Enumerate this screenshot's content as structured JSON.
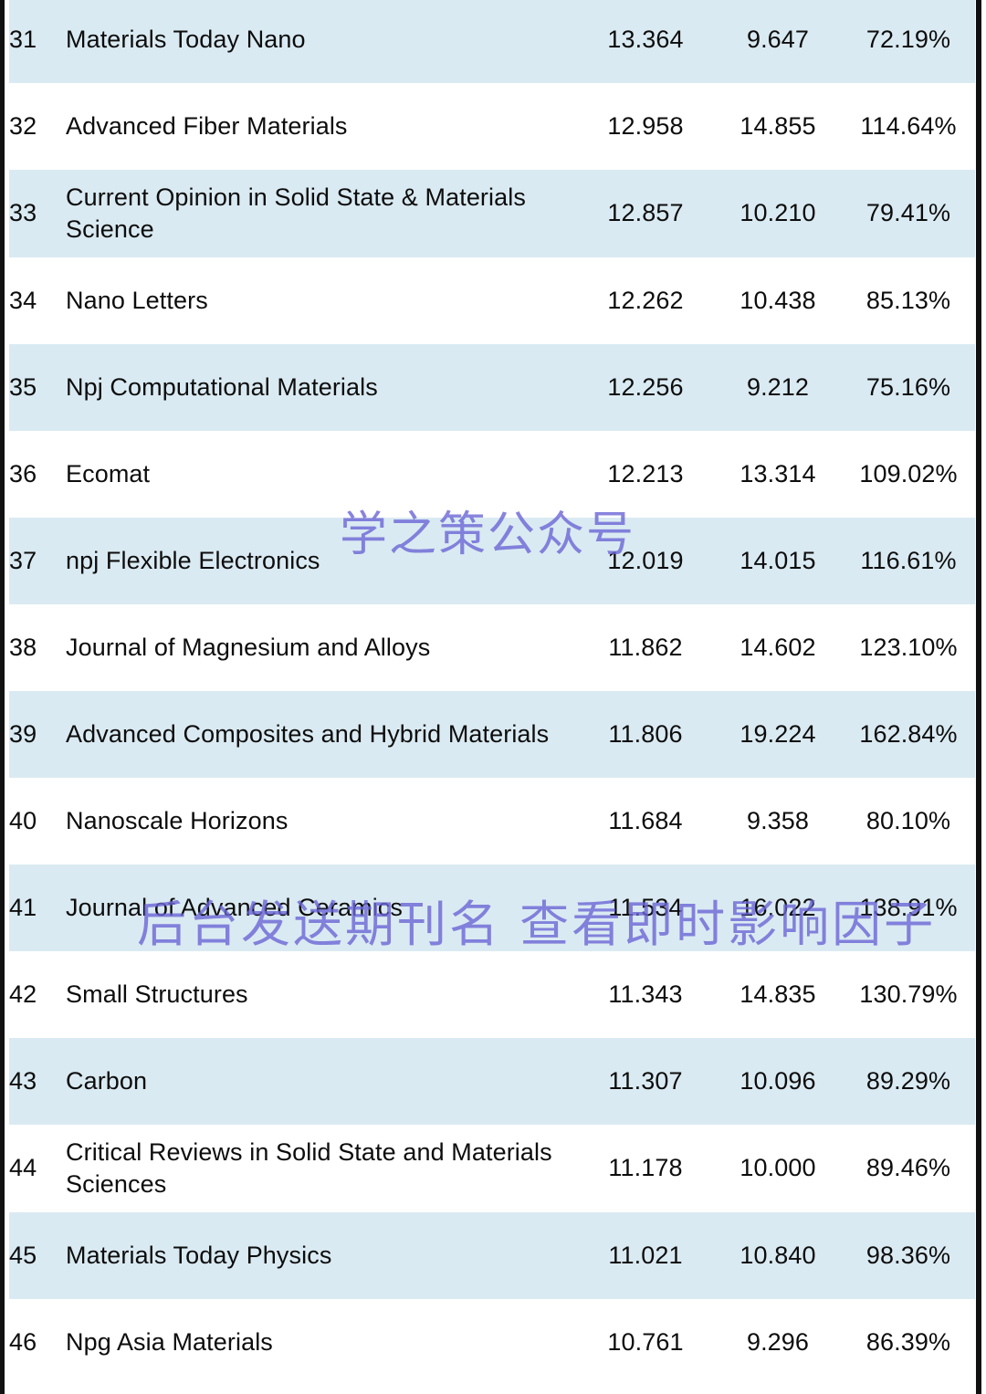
{
  "page": {
    "background_color": "#ffffff",
    "shaded_row_color": "#daeaf2",
    "text_color": "#0d0d0d",
    "edge_color": "#111111"
  },
  "watermarks": {
    "top": "学之策公众号",
    "middle": "后台发送期刊名 查看即时影响因子",
    "color": "#6b66d6"
  },
  "table": {
    "columns": [
      "rank",
      "journal",
      "impact_factor",
      "previous_value",
      "ratio"
    ],
    "rows": [
      {
        "rank": "31",
        "journal": "Materials Today Nano",
        "impact_factor": "13.364",
        "previous_value": "9.647",
        "ratio": "72.19%",
        "shaded": true,
        "lines": 1
      },
      {
        "rank": "32",
        "journal": "Advanced Fiber Materials",
        "impact_factor": "12.958",
        "previous_value": "14.855",
        "ratio": "114.64%",
        "shaded": false,
        "lines": 1
      },
      {
        "rank": "33",
        "journal": "Current Opinion in Solid State & Materials Science",
        "impact_factor": "12.857",
        "previous_value": "10.210",
        "ratio": "79.41%",
        "shaded": true,
        "lines": 2
      },
      {
        "rank": "34",
        "journal": "Nano Letters",
        "impact_factor": "12.262",
        "previous_value": "10.438",
        "ratio": "85.13%",
        "shaded": false,
        "lines": 1
      },
      {
        "rank": "35",
        "journal": "Npj Computational Materials",
        "impact_factor": "12.256",
        "previous_value": "9.212",
        "ratio": "75.16%",
        "shaded": true,
        "lines": 1
      },
      {
        "rank": "36",
        "journal": "Ecomat",
        "impact_factor": "12.213",
        "previous_value": "13.314",
        "ratio": "109.02%",
        "shaded": false,
        "lines": 1
      },
      {
        "rank": "37",
        "journal": "npj Flexible Electronics",
        "impact_factor": "12.019",
        "previous_value": "14.015",
        "ratio": "116.61%",
        "shaded": true,
        "lines": 1
      },
      {
        "rank": "38",
        "journal": "Journal of Magnesium and Alloys",
        "impact_factor": "11.862",
        "previous_value": "14.602",
        "ratio": "123.10%",
        "shaded": false,
        "lines": 1
      },
      {
        "rank": "39",
        "journal": "Advanced Composites and Hybrid Materials",
        "impact_factor": "11.806",
        "previous_value": "19.224",
        "ratio": "162.84%",
        "shaded": true,
        "lines": 1
      },
      {
        "rank": "40",
        "journal": "Nanoscale Horizons",
        "impact_factor": "11.684",
        "previous_value": "9.358",
        "ratio": "80.10%",
        "shaded": false,
        "lines": 1
      },
      {
        "rank": "41",
        "journal": "Journal of Advanced Ceramics",
        "impact_factor": "11.534",
        "previous_value": "16.022",
        "ratio": "138.91%",
        "shaded": true,
        "lines": 1
      },
      {
        "rank": "42",
        "journal": "Small Structures",
        "impact_factor": "11.343",
        "previous_value": "14.835",
        "ratio": "130.79%",
        "shaded": false,
        "lines": 1
      },
      {
        "rank": "43",
        "journal": "Carbon",
        "impact_factor": "11.307",
        "previous_value": "10.096",
        "ratio": "89.29%",
        "shaded": true,
        "lines": 1
      },
      {
        "rank": "44",
        "journal": "Critical Reviews in Solid State and Materials Sciences",
        "impact_factor": "11.178",
        "previous_value": "10.000",
        "ratio": "89.46%",
        "shaded": false,
        "lines": 2
      },
      {
        "rank": "45",
        "journal": "Materials Today Physics",
        "impact_factor": "11.021",
        "previous_value": "10.840",
        "ratio": "98.36%",
        "shaded": true,
        "lines": 1
      },
      {
        "rank": "46",
        "journal": "Npg Asia Materials",
        "impact_factor": "10.761",
        "previous_value": "9.296",
        "ratio": "86.39%",
        "shaded": false,
        "lines": 1
      }
    ]
  }
}
